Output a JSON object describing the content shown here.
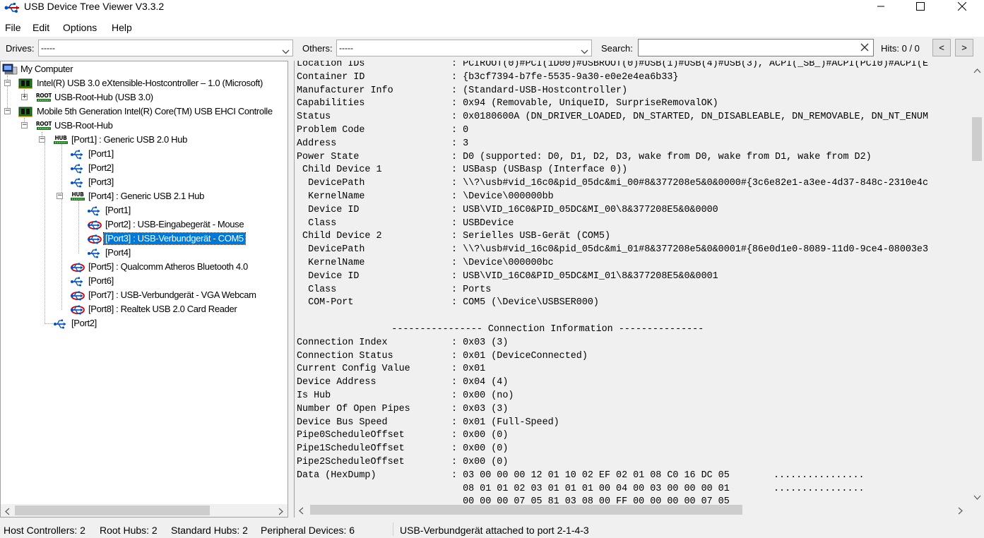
{
  "window": {
    "title": "USB Device Tree Viewer V3.3.2",
    "controls": [
      "minimize",
      "maximize",
      "close"
    ]
  },
  "menu": [
    "File",
    "Edit",
    "Options",
    "Help"
  ],
  "toolbar": {
    "drives_label": "Drives:",
    "drives_value": "-----",
    "others_label": "Others:",
    "others_value": "-----",
    "search_label": "Search:",
    "search_value": "",
    "hits_label": "Hits: 0 / 0",
    "prev_glyph": "<",
    "next_glyph": ">"
  },
  "tree": {
    "nodes": [
      {
        "label": "My Computer",
        "icon": "computer-icon"
      },
      {
        "label": "Intel(R) USB 3.0 eXtensible-Hostcontroller – 1.0 (Microsoft)",
        "icon": "host-controller-icon"
      },
      {
        "label": "USB-Root-Hub (USB 3.0)",
        "icon": "root-hub-icon",
        "icon_text": "ROOT"
      },
      {
        "label": "Mobile 5th Generation Intel(R) Core(TM) USB EHCI Controlle",
        "icon": "host-controller-icon"
      },
      {
        "label": "USB-Root-Hub",
        "icon": "root-hub-icon",
        "icon_text": "ROOT"
      },
      {
        "label": "[Port1] : Generic USB 2.0 Hub",
        "icon": "hub-icon",
        "icon_text": "HUB"
      },
      {
        "label": "[Port1]",
        "icon": "usb-port-icon"
      },
      {
        "label": "[Port2]",
        "icon": "usb-port-icon"
      },
      {
        "label": "[Port3]",
        "icon": "usb-port-icon"
      },
      {
        "label": "[Port4] : Generic USB 2.1 Hub",
        "icon": "hub-icon",
        "icon_text": "HUB"
      },
      {
        "label": "[Port1]",
        "icon": "usb-port-icon"
      },
      {
        "label": "[Port2] : USB-Eingabegerät - Mouse",
        "icon": "usb-device-icon"
      },
      {
        "label": "[Port3] : USB-Verbundgerät - COM5",
        "icon": "usb-device-icon",
        "selected": true
      },
      {
        "label": "[Port4]",
        "icon": "usb-port-icon"
      },
      {
        "label": "[Port5] : Qualcomm Atheros Bluetooth 4.0",
        "icon": "usb-device-icon"
      },
      {
        "label": "[Port6]",
        "icon": "usb-port-icon"
      },
      {
        "label": "[Port7] : USB-Verbundgerät - VGA Webcam",
        "icon": "usb-device-icon"
      },
      {
        "label": "[Port8] : Realtek USB 2.0 Card Reader",
        "icon": "usb-device-icon"
      },
      {
        "label": "[Port2]",
        "icon": "usb-port-icon"
      }
    ]
  },
  "details": {
    "lines": [
      {
        "k": "Location IDs",
        "v": ": PCIROOT(0)#PCI(1D00)#USBROOT(0)#USB(1)#USB(4)#USB(3), ACPI(_SB_)#ACPI(PCI0)#ACPI(E"
      },
      {
        "k": "Container ID",
        "v": ": {b3cf7394-b7fe-5535-9a30-e0e2e4ea6b33}"
      },
      {
        "k": "Manufacturer Info",
        "v": ": (Standard-USB-Hostcontroller)"
      },
      {
        "k": "Capabilities",
        "v": ": 0x94 (Removable, UniqueID, SurpriseRemovalOK)"
      },
      {
        "k": "Status",
        "v": ": 0x0180600A (DN_DRIVER_LOADED, DN_STARTED, DN_DISABLEABLE, DN_REMOVABLE, DN_NT_ENUM"
      },
      {
        "k": "Problem Code",
        "v": ": 0"
      },
      {
        "k": "Address",
        "v": ": 3"
      },
      {
        "k": "Power State",
        "v": ": D0 (supported: D0, D1, D2, D3, wake from D0, wake from D1, wake from D2)"
      },
      {
        "k": " Child Device 1",
        "v": ": USBasp (USBasp (Interface 0))"
      },
      {
        "k": "  DevicePath",
        "v": ": \\\\?\\usb#vid_16c0&pid_05dc&mi_00#8&377208e5&0&0000#{3c6e82e1-a3ee-4d37-848c-2310e4c"
      },
      {
        "k": "  KernelName",
        "v": ": \\Device\\000000bb"
      },
      {
        "k": "  Device ID",
        "v": ": USB\\VID_16C0&PID_05DC&MI_00\\8&377208E5&0&0000"
      },
      {
        "k": "  Class",
        "v": ": USBDevice"
      },
      {
        "k": " Child Device 2",
        "v": ": Serielles USB-Gerät (COM5)"
      },
      {
        "k": "  DevicePath",
        "v": ": \\\\?\\usb#vid_16c0&pid_05dc&mi_01#8&377208e5&0&0001#{86e0d1e0-8089-11d0-9ce4-08003e3"
      },
      {
        "k": "  KernelName",
        "v": ": \\Device\\000000bc"
      },
      {
        "k": "  Device ID",
        "v": ": USB\\VID_16C0&PID_05DC&MI_01\\8&377208E5&0&0001"
      },
      {
        "k": "  Class",
        "v": ": Ports"
      },
      {
        "k": "  COM-Port",
        "v": ": COM5 (\\Device\\USBSER000)"
      },
      {
        "k": "",
        "v": ""
      },
      {
        "center": "        ---------------- Connection Information ---------------"
      },
      {
        "k": "Connection Index",
        "v": ": 0x03 (3)"
      },
      {
        "k": "Connection Status",
        "v": ": 0x01 (DeviceConnected)"
      },
      {
        "k": "Current Config Value",
        "v": ": 0x01"
      },
      {
        "k": "Device Address",
        "v": ": 0x04 (4)"
      },
      {
        "k": "Is Hub",
        "v": ": 0x00 (no)"
      },
      {
        "k": "Number Of Open Pipes",
        "v": ": 0x03 (3)"
      },
      {
        "k": "Device Bus Speed",
        "v": ": 0x01 (Full-Speed)"
      },
      {
        "k": "Pipe0ScheduleOffset",
        "v": ": 0x00 (0)"
      },
      {
        "k": "Pipe1ScheduleOffset",
        "v": ": 0x00 (0)"
      },
      {
        "k": "Pipe2ScheduleOffset",
        "v": ": 0x00 (0)"
      },
      {
        "k": "Data (HexDump)",
        "v": ": 03 00 00 00 12 01 10 02 EF 02 01 08 C0 16 DC 05",
        "v2": "................"
      },
      {
        "k": "",
        "v": "  08 01 01 02 03 01 01 01 00 04 00 03 00 00 00 01",
        "v2": "................"
      },
      {
        "k": "",
        "v": "  00 00 00 07 05 81 03 08 00 FF 00 00 00 00 07 05"
      }
    ]
  },
  "status": {
    "host_controllers": "Host Controllers: 2",
    "root_hubs": "Root Hubs: 2",
    "standard_hubs": "Standard Hubs: 2",
    "peripheral_devices": "Peripheral Devices: 6",
    "message": "USB-Verbundgerät attached to port 2-1-4-3"
  },
  "colors": {
    "selection": "#0078d7",
    "host_controller_green": "#1e7a1e",
    "usb_blue": "#0050c8",
    "device_red": "#d00000"
  }
}
